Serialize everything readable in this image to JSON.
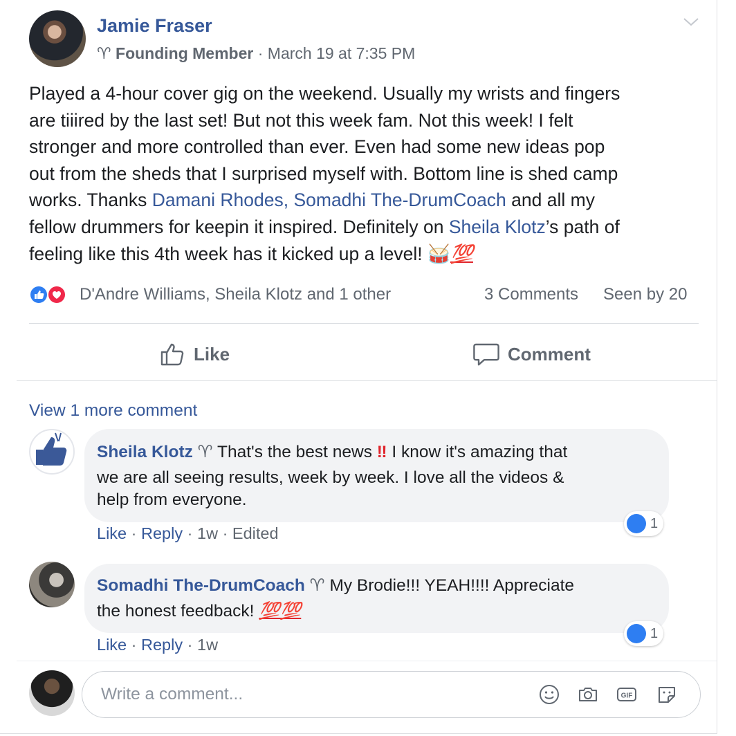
{
  "post": {
    "author": "Jamie Fraser",
    "badge": "Founding Member",
    "timestamp": "· March 19 at 7:35 PM",
    "lines": [
      [
        {
          "t": "Played a 4-hour cover gig on the weekend. Usually my wrists and fingers"
        }
      ],
      [
        {
          "t": "are tiiired by the last set! But not this week fam. Not this week! I felt"
        }
      ],
      [
        {
          "t": "stronger and more controlled than ever. Even had some new ideas pop"
        }
      ],
      [
        {
          "t": "out from the sheds that I surprised myself with. Bottom line is shed camp"
        }
      ],
      [
        {
          "t": "works. Thanks "
        },
        {
          "t": "Damani Rhodes, Somadhi The-DrumCoach",
          "link": true
        },
        {
          "t": " and all my"
        }
      ],
      [
        {
          "t": "fellow drummers for keepin it inspired. Definitely on "
        },
        {
          "t": "Sheila Klotz",
          "link": true
        },
        {
          "t": "’s path of"
        }
      ],
      [
        {
          "t": "feeling like this 4th week has it kicked up a level! "
        },
        {
          "t": "🥁",
          "emoji": true
        },
        {
          "t": "💯",
          "emoji100": true
        }
      ]
    ],
    "reactions_names": "D'Andre Williams, Sheila Klotz and 1 other",
    "comments_count": "3 Comments",
    "seen_by": "Seen by 20",
    "like_label": "Like",
    "comment_label": "Comment"
  },
  "comments_section": {
    "view_more": "View 1 more comment",
    "comments": [
      {
        "name": "Sheila Klotz",
        "line1_a": "That's the best news ",
        "line1_bang": "‼",
        "line1_b": " I know it's amazing that",
        "line2": "we are all seeing results, week by week. I love all the videos &",
        "line3": "help from everyone.",
        "like": "Like",
        "reply": "Reply",
        "meta": " · 1w · Edited",
        "likes": "1"
      },
      {
        "name": "Somadhi The-DrumCoach",
        "line1": "My Brodie!!! YEAH!!!! Appreciate",
        "line2": "the honest feedback! ",
        "emoji": "💯💯",
        "like": "Like",
        "reply": "Reply",
        "meta": " · 1w",
        "likes": "1"
      }
    ],
    "write_placeholder": "Write a comment..."
  },
  "icons": {
    "emoji": "smiley-icon",
    "camera": "camera-icon",
    "gif": "gif-icon",
    "sticker": "sticker-icon"
  },
  "colors": {
    "link": "#365899",
    "meta": "#606770",
    "like_blue": "#2e7ef2",
    "love_red": "#f0284a",
    "bubble": "#f2f3f5"
  }
}
